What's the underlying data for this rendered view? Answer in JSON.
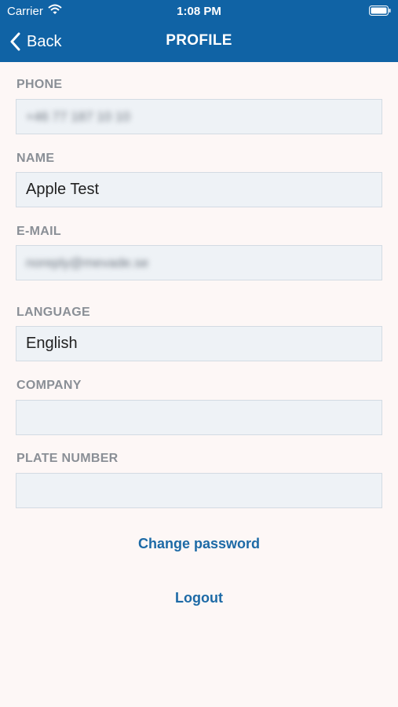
{
  "status": {
    "carrier": "Carrier",
    "time": "1:08 PM"
  },
  "nav": {
    "back_label": "Back",
    "title": "PROFILE"
  },
  "fields": {
    "phone": {
      "label": "PHONE",
      "value": "+46 77 187 10 10"
    },
    "name": {
      "label": "NAME",
      "value": "Apple Test"
    },
    "email": {
      "label": "E-MAIL",
      "value": "noreply@mevade.se"
    },
    "language": {
      "label": "LANGUAGE",
      "value": "English"
    },
    "company": {
      "label": "COMPANY",
      "value": ""
    },
    "plate": {
      "label": "PLATE NUMBER",
      "value": ""
    }
  },
  "actions": {
    "change_password": "Change password",
    "logout": "Logout"
  },
  "colors": {
    "header": "#1063a5",
    "link": "#1d6aa6",
    "background": "#fdf7f6"
  }
}
